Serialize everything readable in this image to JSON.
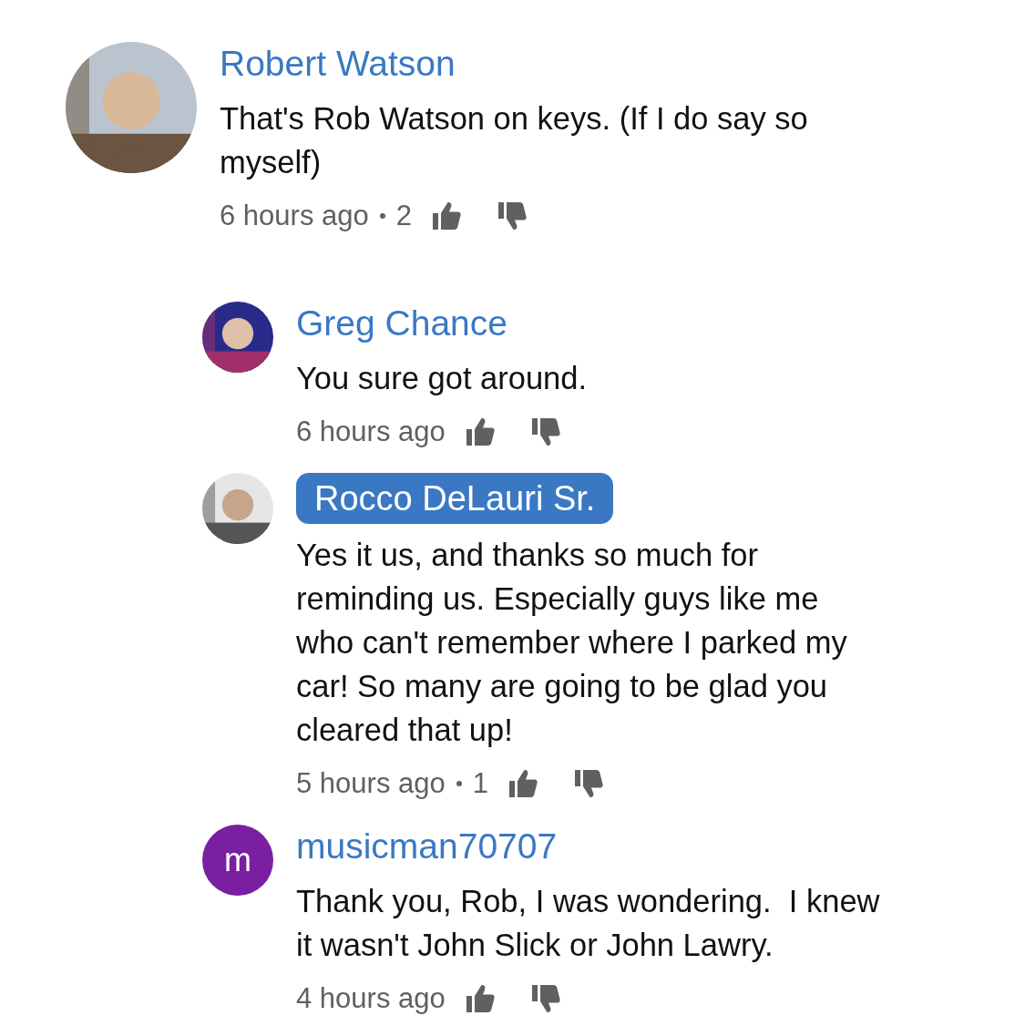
{
  "comments": [
    {
      "author": "Robert Watson",
      "highlighted": false,
      "avatar": {
        "kind": "picture"
      },
      "lines": [
        "That's Rob Watson on keys. (If I do say so",
        "myself)"
      ],
      "time": "6 hours ago",
      "likes": "2",
      "replies": [
        {
          "author": "Greg Chance",
          "highlighted": false,
          "avatar": {
            "kind": "picture"
          },
          "lines": [
            "You sure got around."
          ],
          "time": "6 hours ago"
        },
        {
          "author": "Rocco DeLauri Sr.",
          "highlighted": true,
          "avatar": {
            "kind": "picture"
          },
          "lines": [
            "Yes it us, and thanks so much for",
            "reminding us. Especially guys like me",
            "who can't remember where I parked my",
            "car! So many are going to be glad you",
            "cleared that up!"
          ],
          "time": "5 hours ago",
          "likes": "1"
        },
        {
          "author": "musicman70707",
          "highlighted": false,
          "avatar": {
            "kind": "letter",
            "letter": "m",
            "color": "#7b1fa2"
          },
          "lines": [
            "Thank you, Rob, I was wondering.  I knew",
            "it wasn't John Slick or John Lawry."
          ],
          "time": "4 hours ago"
        }
      ]
    }
  ]
}
